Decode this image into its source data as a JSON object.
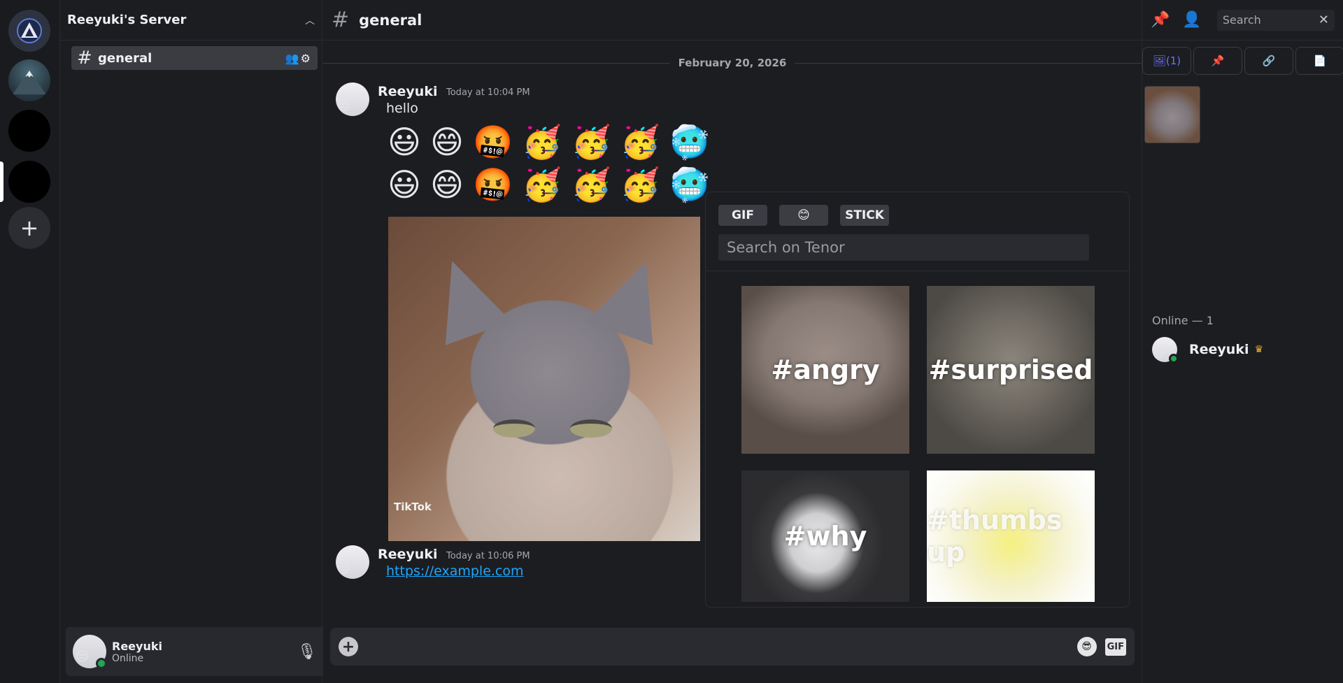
{
  "server": {
    "name": "Reeyuki's Server"
  },
  "channels": [
    {
      "name": "general"
    }
  ],
  "user": {
    "name": "Reeyuki",
    "status": "Online"
  },
  "main": {
    "channel_name": "general",
    "date_separator": "February 20, 2026",
    "messages": [
      {
        "author": "Reeyuki",
        "timestamp": "Today at 10:04 PM",
        "text": "hello",
        "emoji_rows": [
          [
            "😃",
            "😄",
            "🤬",
            "🥳",
            "🥳",
            "🥳",
            "🥶"
          ],
          [
            "😃",
            "😄",
            "🤬",
            "🥳",
            "🥳",
            "🥳",
            "🥶"
          ]
        ],
        "attachment": {
          "watermark": "TikTok"
        }
      },
      {
        "author": "Reeyuki",
        "timestamp": "Today at 10:06 PM",
        "link": "https://example.com"
      }
    ]
  },
  "composer": {
    "gif_label": "GIF"
  },
  "gif_picker": {
    "tabs": [
      "GIF",
      "😊",
      "STICK"
    ],
    "search_placeholder": "Search on Tenor",
    "tiles": [
      "#angry",
      "#surprised",
      "#why",
      "#thumbs up"
    ]
  },
  "right_panel": {
    "search_placeholder": "Search",
    "tabs": [
      "(1)"
    ],
    "online_header": "Online — 1",
    "members": [
      {
        "name": "Reeyuki"
      }
    ]
  },
  "colors": {
    "background": "#1c1d21",
    "accent": "#6c72ff",
    "link": "#1ea7fd",
    "online": "#23a559",
    "crown": "#f0b232"
  }
}
